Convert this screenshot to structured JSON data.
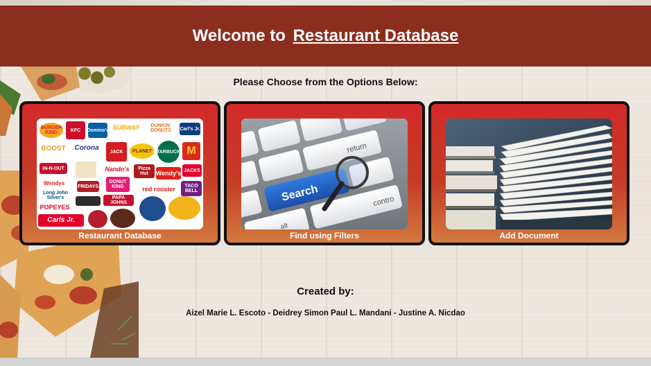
{
  "header": {
    "title_prefix": "Welcome to",
    "title_brand": "Restaurant Database"
  },
  "subtitle": "Please Choose from the Options Below:",
  "options": [
    {
      "label": "Restaurant Database",
      "image": "restaurant-logos-collage"
    },
    {
      "label": "Find using Filters",
      "image": "keyboard-search-key-magnifier",
      "key_text": "Search",
      "key_return": "return",
      "key_alt": "alt",
      "key_ctrl": "contro"
    },
    {
      "label": "Add Document",
      "image": "stack-of-documents"
    }
  ],
  "logos": [
    "BURGER KING",
    "KFC",
    "Domino's",
    "SUBWAY",
    "DUNKIN' DONUTS",
    "Carl's Jr.",
    "BOOST",
    "Corona",
    "JACK",
    "PLANET",
    "STARBUCKS",
    "M",
    "IN-N-OUT",
    "Nando's",
    "Pizza Hut",
    "Wendy's",
    "JACKS",
    "Wendys",
    "FRIDAYS",
    "DONUT KING",
    "red rooster",
    "TACO BELL",
    "Long John Silver's",
    "PAPA JOHNS",
    "POPEYES",
    "Carls Jr."
  ],
  "credits": {
    "heading": "Created by:",
    "authors": "Aizel Marie L. Escoto - Deidrey Simon Paul L. Mandani - Justine A. Nicdao"
  },
  "colors": {
    "header_bg": "#8b2e1d",
    "card_top": "#d42a2a",
    "card_bottom": "#d2793e",
    "search_key": "#1e63c9"
  }
}
